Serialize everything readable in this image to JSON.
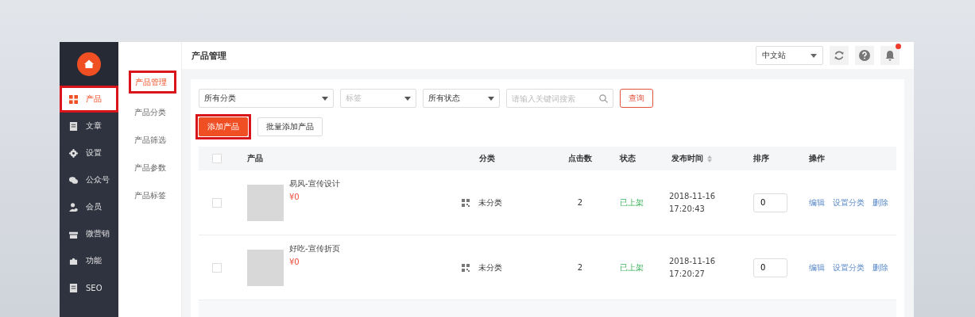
{
  "sidebar": {
    "items": [
      {
        "label": "产品",
        "selected": true,
        "highlighted": true
      },
      {
        "label": "文章",
        "selected": false,
        "highlighted": false
      },
      {
        "label": "设置",
        "selected": false,
        "highlighted": false
      },
      {
        "label": "公众号",
        "selected": false,
        "highlighted": false
      },
      {
        "label": "会员",
        "selected": false,
        "highlighted": false
      },
      {
        "label": "微营销",
        "selected": false,
        "highlighted": false
      },
      {
        "label": "功能",
        "selected": false,
        "highlighted": false
      },
      {
        "label": "SEO",
        "selected": false,
        "highlighted": false
      }
    ]
  },
  "subnav": {
    "items": [
      {
        "label": "产品管理",
        "selected": true,
        "highlighted": true
      },
      {
        "label": "产品分类",
        "selected": false,
        "highlighted": false
      },
      {
        "label": "产品筛选",
        "selected": false,
        "highlighted": false
      },
      {
        "label": "产品参数",
        "selected": false,
        "highlighted": false
      },
      {
        "label": "产品标签",
        "selected": false,
        "highlighted": false
      }
    ]
  },
  "header": {
    "title": "产品管理",
    "site_select": "中文站",
    "notification_dot": true
  },
  "filters": [
    {
      "kind": "select",
      "value": "所有分类"
    },
    {
      "kind": "select",
      "placeholder": "标签"
    },
    {
      "kind": "select",
      "value": "所有状态"
    },
    {
      "kind": "search",
      "placeholder": "请输入关键词搜索"
    }
  ],
  "query_button": "查询",
  "buttons": [
    {
      "label": "添加产品",
      "primary": true,
      "highlighted": true
    },
    {
      "label": "批量添加产品",
      "primary": false,
      "highlighted": false
    }
  ],
  "table": {
    "select_all_checked": false,
    "columns": [
      "产品",
      "分类",
      "点击数",
      "状态",
      "发布时间",
      "排序",
      "操作"
    ],
    "rows": [
      {
        "checked": false,
        "name": "易风-宣传设计",
        "price": "¥0",
        "category": "未分类",
        "clicks": "2",
        "status": "已上架",
        "date": "2018-11-16",
        "time": "17:20:43",
        "order": "0",
        "actions": [
          "编辑",
          "设置分类",
          "删除"
        ]
      },
      {
        "checked": false,
        "name": "好吃-宣传折页",
        "price": "¥0",
        "category": "未分类",
        "clicks": "2",
        "status": "已上架",
        "date": "2018-11-16",
        "time": "17:20:27",
        "order": "0",
        "actions": [
          "编辑",
          "设置分类",
          "删除"
        ]
      }
    ]
  }
}
